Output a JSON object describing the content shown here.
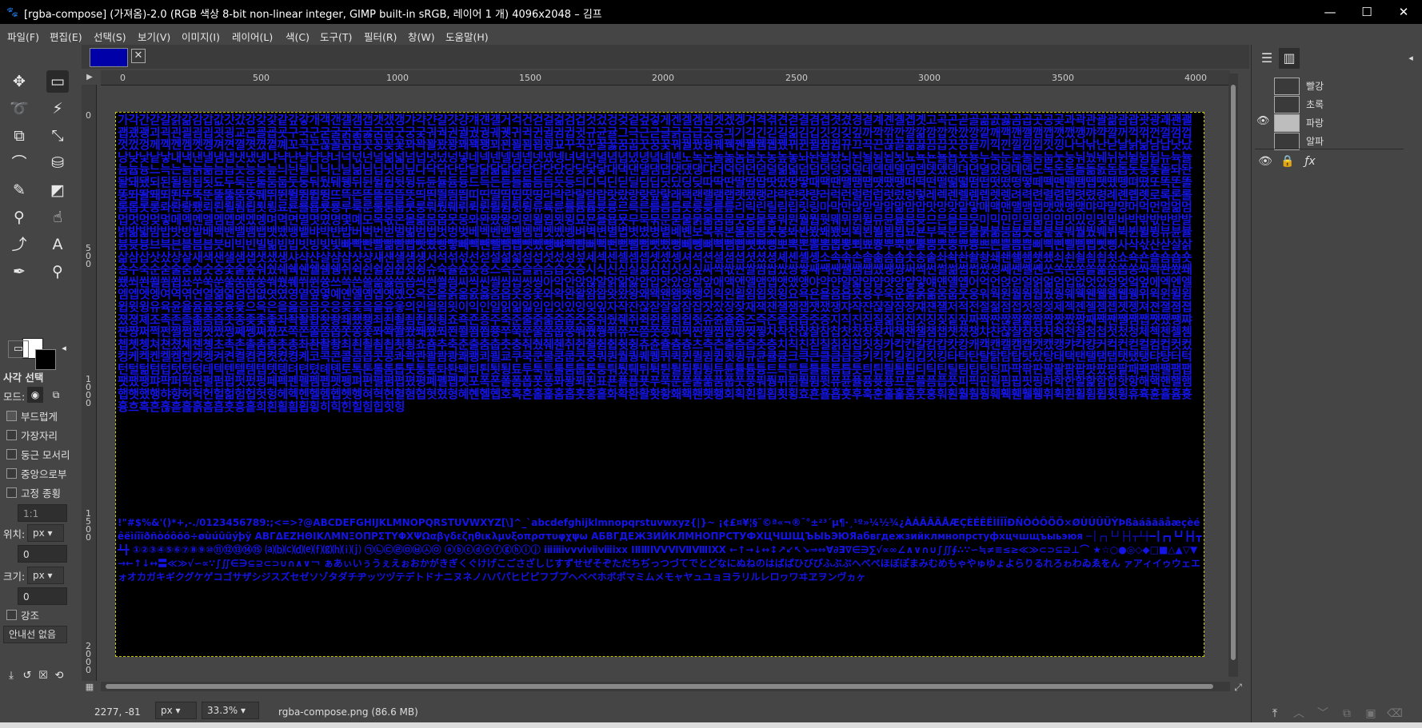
{
  "window": {
    "title": "[rgba-compose] (가져옴)-2.0 (RGB 색상 8-bit non-linear integer, GIMP built-in sRGB, 레이어 1 개) 4096x2048 – 김프",
    "minimize": "—",
    "maximize": "☐",
    "close": "✕"
  },
  "menu": [
    "파일(F)",
    "편집(E)",
    "선택(S)",
    "보기(V)",
    "이미지(I)",
    "레이어(L)",
    "색(C)",
    "도구(T)",
    "필터(R)",
    "창(W)",
    "도움말(H)"
  ],
  "tool_options": {
    "title": "사각 선택",
    "mode_label": "모드:",
    "antialias": "부드럽게",
    "feather": "가장자리",
    "rounded": "둥근 모서리",
    "expand_center": "중앙으로부",
    "fixed": "고정 종횡",
    "fixed_value": "1:1",
    "position_label": "위치:",
    "position_unit": "px",
    "position_value": "0",
    "size_label": "크기:",
    "size_unit": "px",
    "size_value": "0",
    "highlight": "강조",
    "guides": "안내선 없음"
  },
  "ruler": {
    "h_ticks": [
      "0",
      "500",
      "1000",
      "1500",
      "2000",
      "2500",
      "3000",
      "3500",
      "4000"
    ],
    "v_ticks": [
      "0",
      "5\n0\n0",
      "1\n0\n0\n0",
      "1\n5\n0\n0",
      "2\n0\n0\n0"
    ]
  },
  "status": {
    "coords": "2277, -81",
    "unit": "px",
    "zoom": "33.3%",
    "file": "rgba-compose.png (86.6 MB)"
  },
  "channels": [
    {
      "name": "빨강",
      "visible": false
    },
    {
      "name": "초록",
      "visible": false
    },
    {
      "name": "파랑",
      "visible": true
    },
    {
      "name": "알파",
      "visible": false
    }
  ],
  "colors": {
    "glyph": "#1414e6",
    "canvas": "#000000",
    "ui_bg": "#454545"
  }
}
